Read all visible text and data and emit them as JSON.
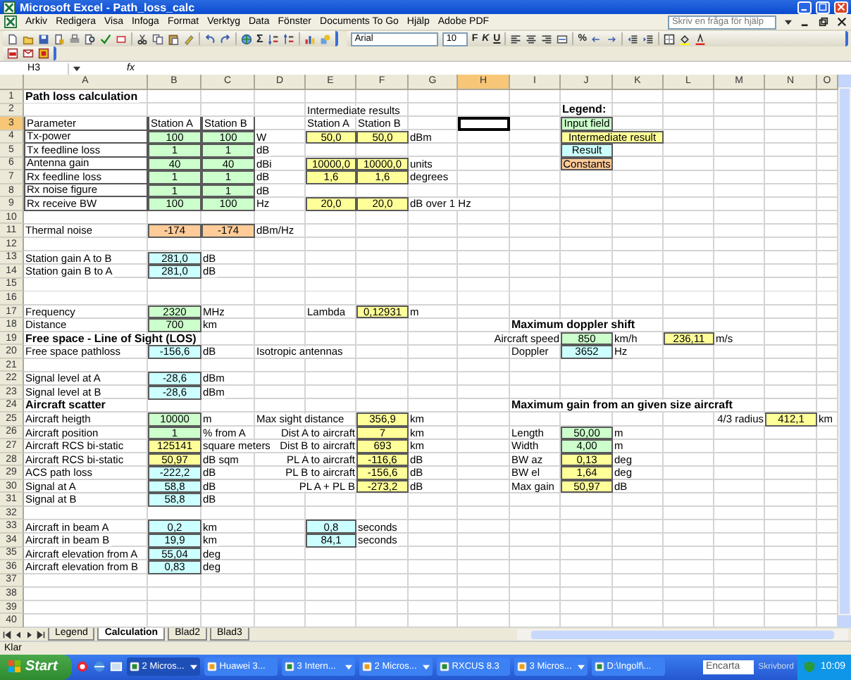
{
  "window": {
    "title": "Microsoft Excel - Path_loss_calc"
  },
  "menu": [
    "Arkiv",
    "Redigera",
    "Visa",
    "Infoga",
    "Format",
    "Verktyg",
    "Data",
    "Fönster",
    "Documents To Go",
    "Hjälp",
    "Adobe PDF"
  ],
  "help_search": {
    "placeholder": "Skriv en fråga för hjälp"
  },
  "toolbar": {
    "sum_label": "Σ",
    "font": "Arial",
    "font_size": "10",
    "bold_label": "F",
    "italic_label": "K",
    "underline_label": "U",
    "percent_label": "%"
  },
  "formula_bar": {
    "name_box": "H3",
    "fx_label": "fx"
  },
  "sheet": {
    "columns": [
      "A",
      "B",
      "C",
      "D",
      "E",
      "F",
      "G",
      "H",
      "I",
      "J",
      "K",
      "L",
      "M",
      "N",
      "O"
    ],
    "rows": [
      {
        "number": "1",
        "cells": [
          {
            "text": "Path loss calculation",
            "kind": "heading"
          }
        ]
      },
      {
        "number": "2",
        "cells": [
          null,
          null,
          null,
          null,
          {
            "text": "Intermediate results"
          },
          null,
          null,
          null,
          null,
          {
            "text": "Legend:",
            "kind": "heading"
          }
        ]
      },
      {
        "number": "3",
        "cells": [
          {
            "text": "Parameter",
            "bordered": true
          },
          {
            "text": "Station A",
            "bordered": true
          },
          {
            "text": "Station B",
            "bordered": true
          },
          null,
          {
            "text": "Station A"
          },
          {
            "text": "Station B"
          },
          null,
          {
            "selected": true
          },
          null,
          {
            "text": "Input field",
            "kind": "input"
          }
        ]
      },
      {
        "number": "4",
        "cells": [
          {
            "text": "Tx-power",
            "bordered": true
          },
          {
            "text": "100",
            "kind": "input"
          },
          {
            "text": "100",
            "kind": "input"
          },
          {
            "text": "W"
          },
          {
            "text": "50,0",
            "kind": "intermediate"
          },
          {
            "text": "50,0",
            "kind": "intermediate"
          },
          {
            "text": "dBm"
          },
          null,
          null,
          {
            "text": "Intermediate result",
            "kind": "intermediate",
            "merged": true
          }
        ]
      },
      {
        "number": "5",
        "cells": [
          {
            "text": "Tx feedline loss",
            "bordered": true
          },
          {
            "text": "1",
            "kind": "input"
          },
          {
            "text": "1",
            "kind": "input"
          },
          {
            "text": "dB"
          },
          null,
          null,
          null,
          null,
          null,
          {
            "text": "Result",
            "kind": "result"
          }
        ]
      },
      {
        "number": "6",
        "cells": [
          {
            "text": "Antenna gain",
            "bordered": true
          },
          {
            "text": "40",
            "kind": "input"
          },
          {
            "text": "40",
            "kind": "input"
          },
          {
            "text": "dBi"
          },
          {
            "text": "10000,0",
            "kind": "intermediate"
          },
          {
            "text": "10000,0",
            "kind": "intermediate"
          },
          {
            "text": "units"
          },
          null,
          null,
          {
            "text": "Constants",
            "kind": "constant"
          }
        ]
      },
      {
        "number": "7",
        "cells": [
          {
            "text": "Rx feedline loss",
            "bordered": true
          },
          {
            "text": "1",
            "kind": "input"
          },
          {
            "text": "1",
            "kind": "input"
          },
          {
            "text": "dB"
          },
          {
            "text": "1,6",
            "kind": "intermediate"
          },
          {
            "text": "1,6",
            "kind": "intermediate"
          },
          {
            "text": "degrees"
          }
        ]
      },
      {
        "number": "8",
        "cells": [
          {
            "text": "Rx noise figure",
            "bordered": true
          },
          {
            "text": "1",
            "kind": "input"
          },
          {
            "text": "1",
            "kind": "input"
          },
          {
            "text": "dB"
          }
        ]
      },
      {
        "number": "9",
        "cells": [
          {
            "text": "Rx receive BW",
            "bordered": true
          },
          {
            "text": "100",
            "kind": "input"
          },
          {
            "text": "100",
            "kind": "input"
          },
          {
            "text": "Hz"
          },
          {
            "text": "20,0",
            "kind": "intermediate"
          },
          {
            "text": "20,0",
            "kind": "intermediate"
          },
          {
            "text": "dB over 1 Hz"
          }
        ]
      },
      {
        "number": "10"
      },
      {
        "number": "11",
        "cells": [
          {
            "text": "Thermal noise"
          },
          {
            "text": "-174",
            "kind": "constant"
          },
          {
            "text": "-174",
            "kind": "constant"
          },
          {
            "text": "dBm/Hz"
          }
        ]
      },
      {
        "number": "12"
      },
      {
        "number": "13",
        "cells": [
          {
            "text": "Station gain A to B"
          },
          {
            "text": "281,0",
            "kind": "result"
          },
          {
            "text": "dB"
          }
        ]
      },
      {
        "number": "14",
        "cells": [
          {
            "text": "Station gain B to A"
          },
          {
            "text": "281,0",
            "kind": "result"
          },
          {
            "text": "dB"
          }
        ]
      },
      {
        "number": "15"
      },
      {
        "number": "16"
      },
      {
        "number": "17",
        "cells": [
          {
            "text": "Frequency"
          },
          {
            "text": "2320",
            "kind": "input"
          },
          {
            "text": "MHz"
          },
          null,
          {
            "text": "Lambda"
          },
          {
            "text": "0,12931",
            "kind": "intermediate"
          },
          {
            "text": "m"
          }
        ]
      },
      {
        "number": "18",
        "cells": [
          {
            "text": "Distance"
          },
          {
            "text": "700",
            "kind": "input"
          },
          {
            "text": "km"
          },
          null,
          null,
          null,
          null,
          null,
          {
            "text": "Maximum doppler shift",
            "kind": "heading"
          }
        ]
      },
      {
        "number": "19",
        "cells": [
          {
            "text": "Free space - Line of Sight (LOS)",
            "kind": "heading"
          },
          null,
          null,
          null,
          null,
          null,
          null,
          null,
          {
            "text": "Aircraft speed",
            "kind": "right_label"
          },
          {
            "text": "850",
            "kind": "input"
          },
          {
            "text": "km/h"
          },
          {
            "text": "236,11",
            "kind": "intermediate"
          },
          {
            "text": "m/s"
          }
        ]
      },
      {
        "number": "20",
        "cells": [
          {
            "text": "Free space pathloss"
          },
          {
            "text": "-156,6",
            "kind": "result"
          },
          {
            "text": "dB"
          },
          {
            "text": "Isotropic antennas"
          },
          null,
          null,
          null,
          null,
          {
            "text": "Doppler"
          },
          {
            "text": "3652",
            "kind": "result"
          },
          {
            "text": "Hz"
          }
        ]
      },
      {
        "number": "21"
      },
      {
        "number": "22",
        "cells": [
          {
            "text": "Signal level at A"
          },
          {
            "text": "-28,6",
            "kind": "result"
          },
          {
            "text": "dBm"
          }
        ]
      },
      {
        "number": "23",
        "cells": [
          {
            "text": "Signal level at B"
          },
          {
            "text": "-28,6",
            "kind": "result"
          },
          {
            "text": "dBm"
          }
        ]
      },
      {
        "number": "24",
        "cells": [
          {
            "text": "Aircraft scatter",
            "kind": "heading"
          },
          null,
          null,
          null,
          null,
          null,
          null,
          null,
          {
            "text": "Maximum gain from an given size aircraft",
            "kind": "heading"
          }
        ]
      },
      {
        "number": "25",
        "cells": [
          {
            "text": "Aircraft heigth"
          },
          {
            "text": "10000",
            "kind": "input"
          },
          {
            "text": "m"
          },
          {
            "text": "Max sight distance"
          },
          null,
          {
            "text": "356,9",
            "kind": "intermediate"
          },
          {
            "text": "km"
          },
          null,
          null,
          null,
          null,
          null,
          {
            "text": "4/3 radius",
            "kind": "right_label"
          },
          {
            "text": "412,1",
            "kind": "intermediate"
          },
          {
            "text": "km"
          }
        ]
      },
      {
        "number": "26",
        "cells": [
          {
            "text": "Aircraft position"
          },
          {
            "text": "1",
            "kind": "input"
          },
          {
            "text": "% from A"
          },
          null,
          {
            "text": "Dist A to aircraft",
            "kind": "right_label"
          },
          {
            "text": "7",
            "kind": "intermediate"
          },
          {
            "text": "km"
          },
          null,
          {
            "text": "Length"
          },
          {
            "text": "50,00",
            "kind": "input"
          },
          {
            "text": "m"
          }
        ]
      },
      {
        "number": "27",
        "cells": [
          {
            "text": "Aircraft RCS bi-static"
          },
          {
            "text": "125141",
            "kind": "intermediate"
          },
          {
            "text": "square meters"
          },
          null,
          {
            "text": "Dist B to aircraft",
            "kind": "right_label"
          },
          {
            "text": "693",
            "kind": "intermediate"
          },
          {
            "text": "km"
          },
          null,
          {
            "text": "Width"
          },
          {
            "text": "4,00",
            "kind": "input"
          },
          {
            "text": "m"
          }
        ]
      },
      {
        "number": "28",
        "cells": [
          {
            "text": "Aircraft RCS bi-static"
          },
          {
            "text": "50,97",
            "kind": "intermediate"
          },
          {
            "text": "dB sqm"
          },
          null,
          {
            "text": "PL A to aircraft",
            "kind": "right_label"
          },
          {
            "text": "-116,6",
            "kind": "intermediate"
          },
          {
            "text": "dB"
          },
          null,
          {
            "text": "BW az"
          },
          {
            "text": "0,13",
            "kind": "intermediate"
          },
          {
            "text": "deg"
          }
        ]
      },
      {
        "number": "29",
        "cells": [
          {
            "text": "ACS path loss"
          },
          {
            "text": "-222,2",
            "kind": "result"
          },
          {
            "text": "dB"
          },
          null,
          {
            "text": "PL B to aircraft",
            "kind": "right_label"
          },
          {
            "text": "-156,6",
            "kind": "intermediate"
          },
          {
            "text": "dB"
          },
          null,
          {
            "text": "BW el"
          },
          {
            "text": "1,64",
            "kind": "intermediate"
          },
          {
            "text": "deg"
          }
        ]
      },
      {
        "number": "30",
        "cells": [
          {
            "text": "Signal at A"
          },
          {
            "text": "58,8",
            "kind": "result"
          },
          {
            "text": "dB"
          },
          null,
          {
            "text": "PL A + PL B",
            "kind": "right_label"
          },
          {
            "text": "-273,2",
            "kind": "intermediate"
          },
          {
            "text": "dB"
          },
          null,
          {
            "text": "Max gain"
          },
          {
            "text": "50,97",
            "kind": "intermediate"
          },
          {
            "text": "dB"
          }
        ]
      },
      {
        "number": "31",
        "cells": [
          {
            "text": "Signal at B"
          },
          {
            "text": "58,8",
            "kind": "result"
          },
          {
            "text": "dB"
          }
        ]
      },
      {
        "number": "32"
      },
      {
        "number": "33",
        "cells": [
          {
            "text": "Aircraft in beam A"
          },
          {
            "text": "0,2",
            "kind": "result"
          },
          {
            "text": "km"
          },
          null,
          {
            "text": "0,8",
            "kind": "result"
          },
          {
            "text": "seconds"
          }
        ]
      },
      {
        "number": "34",
        "cells": [
          {
            "text": "Aircraft in beam B"
          },
          {
            "text": "19,9",
            "kind": "result"
          },
          {
            "text": "km"
          },
          null,
          {
            "text": "84,1",
            "kind": "result"
          },
          {
            "text": "seconds"
          }
        ]
      },
      {
        "number": "35",
        "cells": [
          {
            "text": "Aircraft elevation from A"
          },
          {
            "text": "55,04",
            "kind": "result"
          },
          {
            "text": "deg"
          }
        ]
      },
      {
        "number": "36",
        "cells": [
          {
            "text": "Aircraft elevation from B"
          },
          {
            "text": "0,83",
            "kind": "result"
          },
          {
            "text": "deg"
          }
        ]
      },
      {
        "number": "37"
      },
      {
        "number": "38"
      },
      {
        "number": "39"
      },
      {
        "number": "40"
      }
    ]
  },
  "sheet_tabs": [
    {
      "label": "Legend",
      "selected": false
    },
    {
      "label": "Calculation",
      "selected": true
    },
    {
      "label": "Blad2",
      "selected": false
    },
    {
      "label": "Blad3",
      "selected": false
    }
  ],
  "status_bar": {
    "text": "Klar"
  },
  "taskbar": {
    "start": "Start",
    "tasks": [
      {
        "label": "2 Micros...",
        "grouped": true,
        "selected": true
      },
      {
        "label": "Huawei 3...",
        "grouped": false,
        "selected": false
      },
      {
        "label": "3 Intern...",
        "grouped": true,
        "selected": false
      },
      {
        "label": "2 Micros...",
        "grouped": true,
        "selected": false
      },
      {
        "label": "RXCUS 8.3",
        "grouped": false,
        "selected": false
      },
      {
        "label": "3 Micros...",
        "grouped": true,
        "selected": false
      },
      {
        "label": "D:\\Ingolf\\...",
        "grouped": false,
        "selected": false
      }
    ],
    "search": {
      "placeholder": "Encarta"
    },
    "desk_label": "Skrivbord",
    "clock": "10:09"
  }
}
